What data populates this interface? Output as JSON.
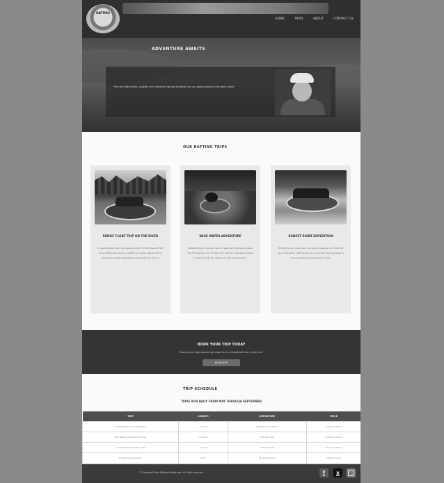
{
  "header": {
    "logo_text": "RAFTING",
    "nav": [
      "HOME",
      "TRIPS",
      "ABOUT",
      "CONTACT US"
    ]
  },
  "hero": {
    "title": "ADVENTURE AWAITS",
    "quote": "\"The river offers thrills, laughter and memories that last a lifetime. Join our expert guides on the water today.\""
  },
  "trips": {
    "title": "OUR RAFTING TRIPS",
    "cards": [
      {
        "title": "FAMILY FLOAT TRIP ON THE RIVER",
        "text": "A relaxing float down calm waters perfect for families and first timers. Enjoy the scenery, wildlife and gentle rapids with an experienced guide leading the way through the canyon."
      },
      {
        "title": "WILD WATER ADVENTURE",
        "text": "Paddle through churning class IV rapids and dramatic gorges. This full day trip is for the bold who want an adrenaline packed journey through the wilderness with expert guides."
      },
      {
        "title": "SUNSET RIVER EXPEDITION",
        "text": "Drift as the sun goes down on a scenic evening run. Finish the day on the water with friends and a riverside meal prepared by our crew before heading back to camp."
      }
    ]
  },
  "cta": {
    "title": "BOOK YOUR TRIP TODAY",
    "subtitle": "Reserve your spot now and get ready for an unforgettable day on the river.",
    "button": "BOOK NOW"
  },
  "schedule": {
    "title": "TRIP SCHEDULE",
    "subtitle": "TRIPS RUN DAILY FROM MAY THROUGH SEPTEMBER",
    "headers": [
      "TRIP",
      "LENGTH",
      "DEPARTURE",
      "PRICE"
    ],
    "rows": [
      [
        "Family Float Trip on the River",
        "3 hours",
        "9:00 am and 1:00 pm",
        "$49 per person"
      ],
      [
        "Wild Water Adventure Full Day",
        "8 hours",
        "8:00 am daily",
        "$129 per person"
      ],
      [
        "Sunset River Expedition Trip",
        "4 hours",
        "5:00 pm daily",
        "$79 per person"
      ],
      [
        "Private Group Charter",
        "Varies",
        "By appointment",
        "Call for quote"
      ]
    ]
  },
  "footer": {
    "text": "© Copyright River Rafting Adventures. All rights reserved.",
    "social": [
      "facebook-icon",
      "x-icon",
      "instagram-icon"
    ]
  }
}
